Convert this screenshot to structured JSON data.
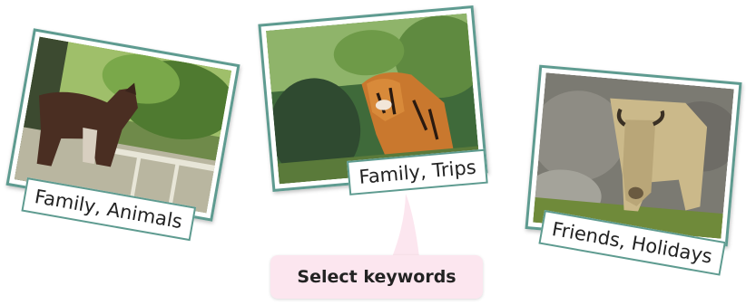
{
  "photos": [
    {
      "subject": "okapi",
      "keywords": "Family, Animals"
    },
    {
      "subject": "tiger",
      "keywords": "Family, Trips"
    },
    {
      "subject": "takin",
      "keywords": "Friends, Holidays"
    }
  ],
  "callout": {
    "text": "Select keywords"
  },
  "colors": {
    "frame": "#5e9b90",
    "callout_bg": "#fce6ef",
    "text": "#222222"
  }
}
